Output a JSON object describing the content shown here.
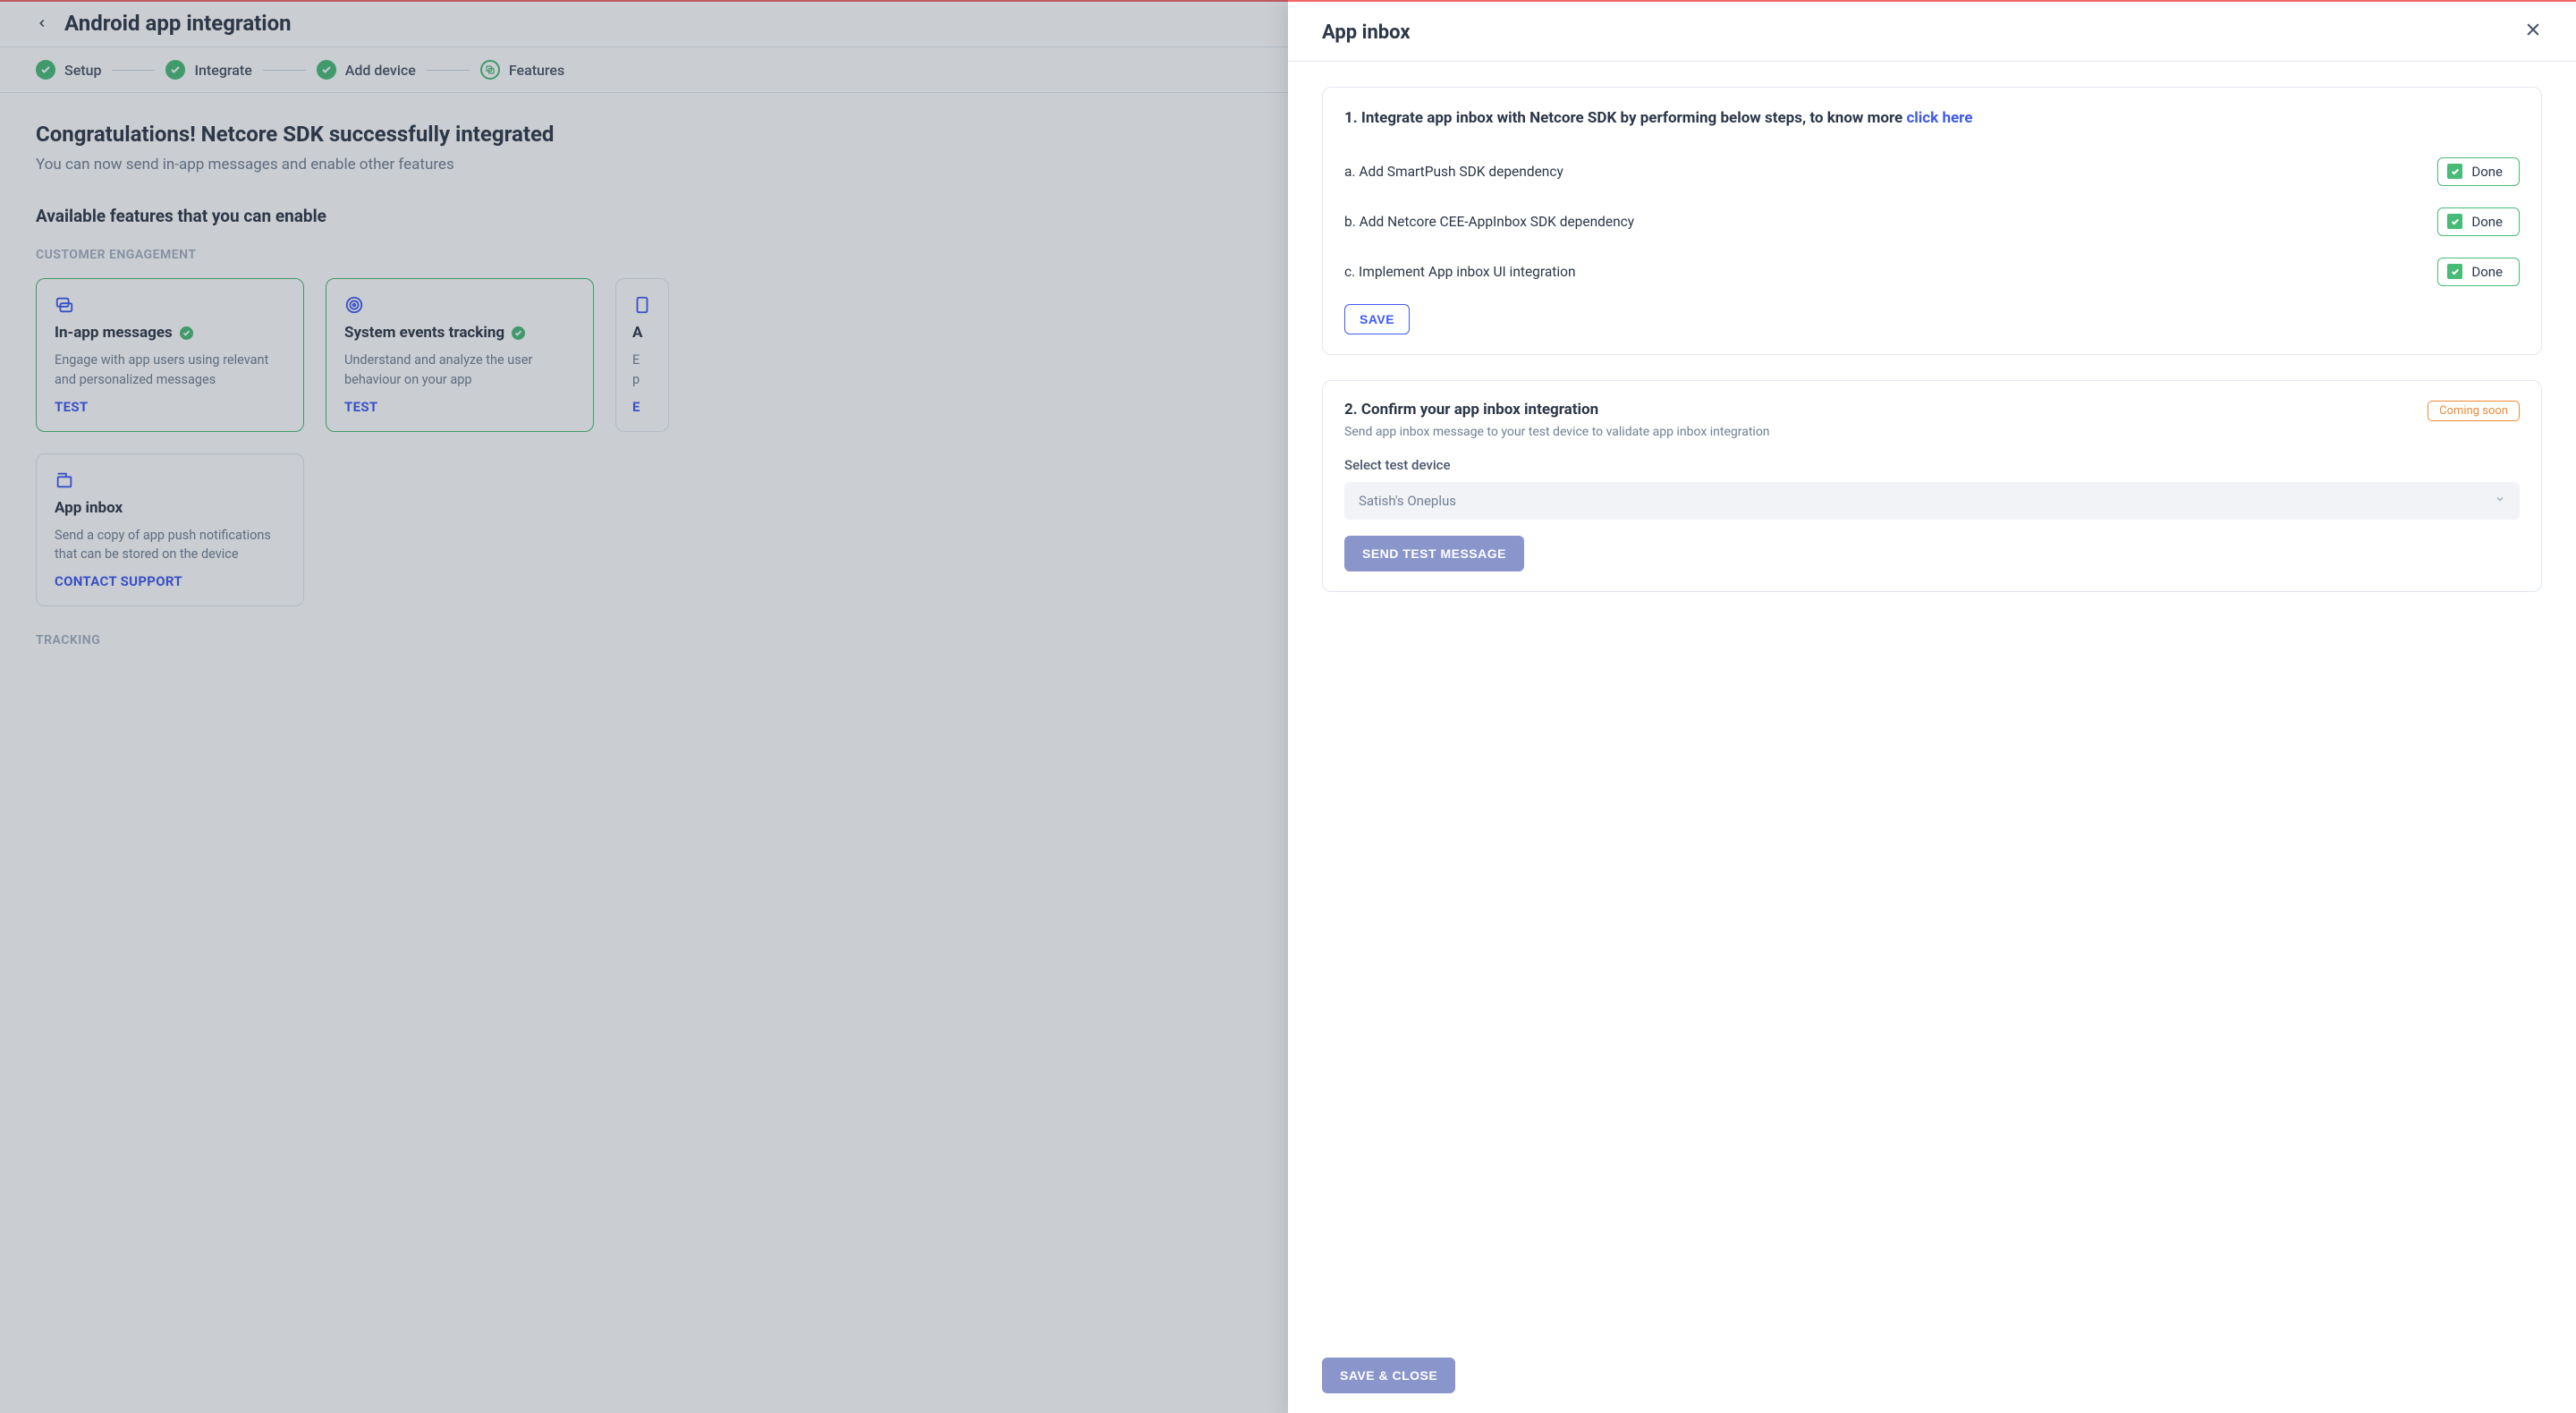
{
  "page": {
    "title": "Android app integration",
    "stepper": [
      "Setup",
      "Integrate",
      "Add device",
      "Features"
    ]
  },
  "main": {
    "congrats_title": "Congratulations! Netcore SDK successfully integrated",
    "congrats_sub": "You can now send in-app messages and enable other features",
    "available_heading": "Available features that you can enable",
    "section_customer": "CUSTOMER ENGAGEMENT",
    "section_tracking": "TRACKING",
    "cards": [
      {
        "title": "In-app messages",
        "desc": "Engage with app users using relevant and personalized messages",
        "action": "TEST"
      },
      {
        "title": "System events tracking",
        "desc": "Understand and analyze the user behaviour on your app",
        "action": "TEST"
      },
      {
        "title": "A",
        "desc_l1": "E",
        "desc_l2": "p",
        "action": "E"
      },
      {
        "title": "App inbox",
        "desc": "Send a copy of app push notifications that can be stored on the device",
        "action": "CONTACT SUPPORT"
      }
    ]
  },
  "drawer": {
    "title": "App inbox",
    "panel1": {
      "heading_pre": "1. Integrate app inbox with Netcore SDK by performing below steps, to know more ",
      "heading_link": "click here",
      "tasks": [
        "a. Add SmartPush SDK dependency",
        "b. Add Netcore CEE-AppInbox SDK dependency",
        "c. Implement App inbox UI integration"
      ],
      "done_label": "Done",
      "save_label": "SAVE"
    },
    "panel2": {
      "title": "2. Confirm your app inbox integration",
      "coming_soon": "Coming soon",
      "sub": "Send app inbox message to your test device to validate app inbox integration",
      "field_label": "Select test device",
      "selected_device": "Satish's Oneplus",
      "send_label": "SEND TEST MESSAGE"
    },
    "footer": {
      "save_close": "SAVE & CLOSE"
    }
  }
}
